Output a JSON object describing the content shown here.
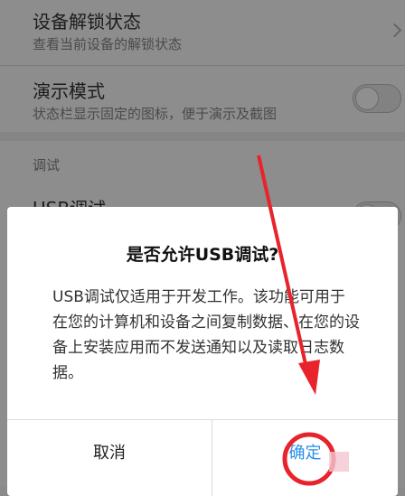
{
  "settings": {
    "unlock_status": {
      "title": "设备解锁状态",
      "subtitle": "查看当前设备的解锁状态"
    },
    "demo_mode": {
      "title": "演示模式",
      "subtitle": "状态栏显示固定的图标，便于演示及截图"
    },
    "debug_section_label": "调试",
    "usb_debug": {
      "title": "USB调试"
    }
  },
  "dialog": {
    "title": "是否允许USB调试?",
    "message": "USB调试仅适用于开发工作。该功能可用于在您的计算机和设备之间复制数据、在您的设备上安装应用而不发送通知以及读取日志数据。",
    "cancel_label": "取消",
    "ok_label": "确定"
  },
  "colors": {
    "annotation_red": "#e8232b",
    "ok_blue": "#2a8fe8"
  }
}
